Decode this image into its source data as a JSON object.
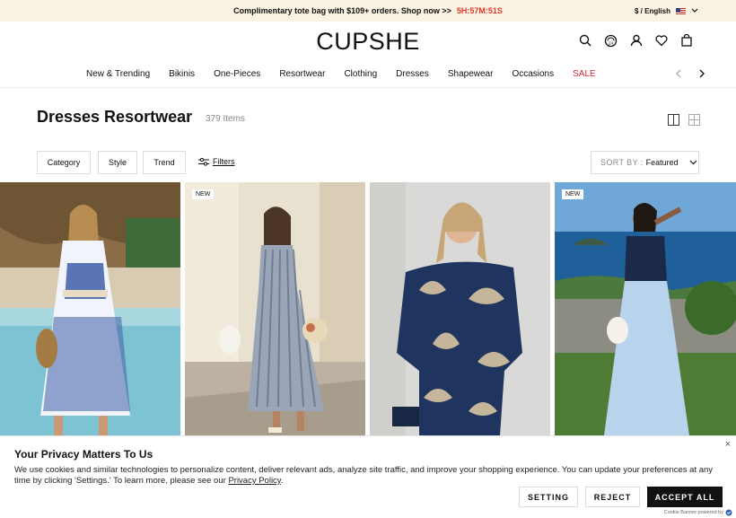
{
  "promo": {
    "text": "Complimentary tote bag with $109+ orders. Shop now >>",
    "timer": "5H:57M:51S",
    "locale": "$ / English"
  },
  "header": {
    "logo": "CUPSHE"
  },
  "nav": {
    "items": [
      "New & Trending",
      "Bikinis",
      "One-Pieces",
      "Resortwear",
      "Clothing",
      "Dresses",
      "Shapewear",
      "Occasions",
      "SALE"
    ]
  },
  "page": {
    "title": "Dresses Resortwear",
    "count": "379 Items"
  },
  "filters": {
    "category": "Category",
    "style": "Style",
    "trend": "Trend",
    "filters": "Filters",
    "sort_key": "SORT BY :",
    "sort_value": "Featured"
  },
  "products": [
    {
      "badge": ""
    },
    {
      "badge": "NEW"
    },
    {
      "badge": ""
    },
    {
      "badge": "NEW"
    }
  ],
  "privacy": {
    "title": "Your Privacy Matters To Us",
    "body": "We use cookies and similar technologies to personalize content, deliver relevant ads, analyze site traffic, and improve your shopping experience. You can update your preferences at any time by clicking 'Settings.' To learn more, please see our",
    "link": "Privacy Policy",
    "period": ".",
    "setting": "SETTING",
    "reject": "REJECT",
    "accept": "ACCEPT ALL",
    "close": "×",
    "powered": "Cookie Banner powered by"
  },
  "colors": {
    "accent": "#111111",
    "sale": "#d9262f",
    "timer": "#e0392b",
    "promo_bg": "#faf3e4"
  },
  "icons": [
    "search-icon",
    "account-24-icon",
    "user-icon",
    "heart-icon",
    "bag-icon"
  ]
}
